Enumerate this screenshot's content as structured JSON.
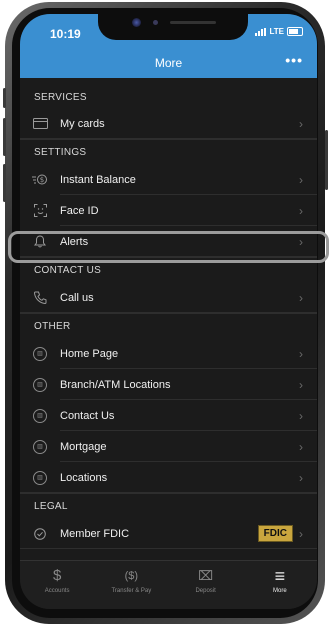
{
  "status": {
    "time": "10:19",
    "network": "LTE"
  },
  "header": {
    "title": "More",
    "more_icon": "ellipsis-icon",
    "more_label": "•••"
  },
  "sections": {
    "services": {
      "title": "SERVICES",
      "items": [
        {
          "label": "My cards",
          "icon": "card-icon"
        }
      ]
    },
    "settings": {
      "title": "SETTINGS",
      "items": [
        {
          "label": "Instant Balance",
          "icon": "instant-balance-icon"
        },
        {
          "label": "Face ID",
          "icon": "face-id-icon"
        },
        {
          "label": "Alerts",
          "icon": "bell-icon"
        }
      ]
    },
    "contact": {
      "title": "CONTACT US",
      "items": [
        {
          "label": "Call us",
          "icon": "phone-icon"
        }
      ]
    },
    "other": {
      "title": "OTHER",
      "items": [
        {
          "label": "Home Page",
          "icon": "bank-icon"
        },
        {
          "label": "Branch/ATM Locations",
          "icon": "bank-icon"
        },
        {
          "label": "Contact Us",
          "icon": "bank-icon"
        },
        {
          "label": "Mortgage",
          "icon": "bank-icon"
        },
        {
          "label": "Locations",
          "icon": "bank-icon"
        }
      ]
    },
    "legal": {
      "title": "LEGAL",
      "items": [
        {
          "label": "Member FDIC",
          "icon": "check-circle-icon",
          "badge": "FDIC"
        }
      ]
    }
  },
  "tabs": [
    {
      "label": "Accounts",
      "icon": "dollar-icon",
      "glyph": "$"
    },
    {
      "label": "Transfer & Pay",
      "icon": "transfer-icon",
      "glyph": "($)"
    },
    {
      "label": "Deposit",
      "icon": "deposit-icon",
      "glyph": "⌧"
    },
    {
      "label": "More",
      "icon": "menu-icon",
      "glyph": "≡"
    }
  ],
  "colors": {
    "header": "#3a8fd1",
    "background": "#1b1b1b",
    "fdic_badge": "#c9a63e",
    "highlight": "#9c9c9c"
  }
}
